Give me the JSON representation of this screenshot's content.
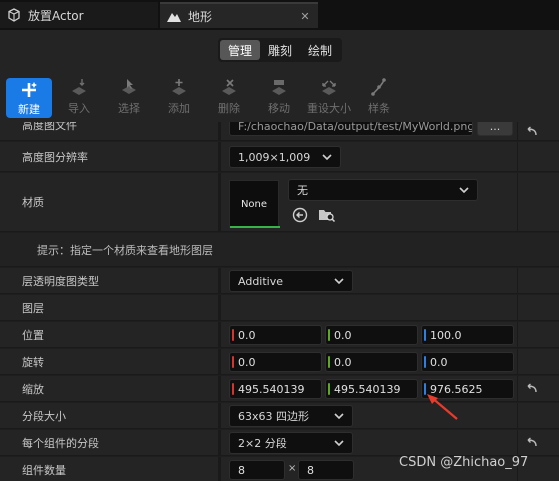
{
  "tabs": [
    {
      "label": "放置Actor",
      "icon": "cube-icon"
    },
    {
      "label": "地形",
      "icon": "mountain-icon"
    }
  ],
  "modes": [
    "管理",
    "雕刻",
    "绘制"
  ],
  "selected_mode": "管理",
  "tools": [
    {
      "label": "新建",
      "icon": "add-icon"
    },
    {
      "label": "导入",
      "icon": "import-icon"
    },
    {
      "label": "选择",
      "icon": "select-icon"
    },
    {
      "label": "添加",
      "icon": "add-component-icon"
    },
    {
      "label": "删除",
      "icon": "delete-icon"
    },
    {
      "label": "移动",
      "icon": "move-icon"
    },
    {
      "label": "重设大小",
      "icon": "resize-icon"
    },
    {
      "label": "样条",
      "icon": "spline-icon"
    }
  ],
  "props": {
    "heightmap_file": {
      "label": "高度图文件",
      "value": "F:/chaochao/Data/output/test/MyWorld.png",
      "browse": "..."
    },
    "heightmap_resolution": {
      "label": "高度图分辨率",
      "value": "1,009×1,009"
    },
    "material": {
      "label": "材质",
      "thumb": "None",
      "value": "无"
    },
    "hint": "提示：指定一个材质来查看地形图层",
    "layer_alpha_type": {
      "label": "层透明度图类型",
      "value": "Additive"
    },
    "layers": {
      "label": "图层"
    },
    "location": {
      "label": "位置",
      "x": "0.0",
      "y": "0.0",
      "z": "100.0"
    },
    "rotation": {
      "label": "旋转",
      "x": "0.0",
      "y": "0.0",
      "z": "0.0"
    },
    "scale": {
      "label": "缩放",
      "x": "495.540139",
      "y": "495.540139",
      "z": "976.5625"
    },
    "section_size": {
      "label": "分段大小",
      "value": "63x63 四边形"
    },
    "sections_per_component": {
      "label": "每个组件的分段",
      "value": "2×2 分段"
    },
    "component_count": {
      "label": "组件数量",
      "x": "8",
      "sep": "×",
      "y": "8"
    }
  },
  "watermark": "CSDN @Zhichao_97",
  "colors": {
    "accent": "#1a7be6",
    "axis_x": "#d1362f",
    "axis_y": "#5fa823",
    "axis_z": "#2f7fe0",
    "arrow": "#e83b2c"
  }
}
